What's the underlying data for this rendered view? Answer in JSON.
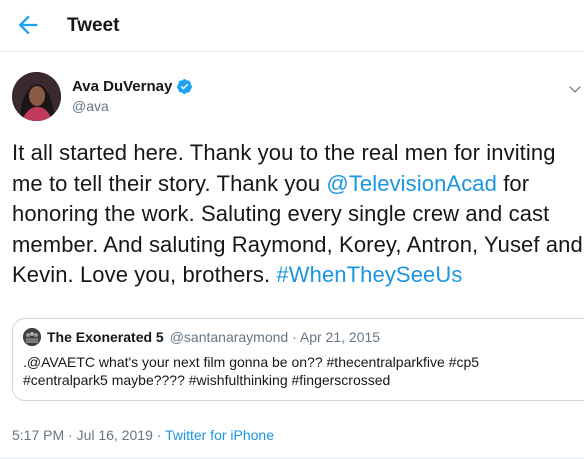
{
  "header": {
    "title": "Tweet"
  },
  "author": {
    "name": "Ava DuVernay",
    "handle": "@ava"
  },
  "tweet": {
    "segments": [
      {
        "text": "It all started here. Thank you to the real men for inviting me to tell their story. Thank you ",
        "link": false
      },
      {
        "text": "@TelevisionAcad",
        "link": true
      },
      {
        "text": " for honoring the work. Saluting every single crew and cast member. And saluting Raymond, Korey, Antron, Yusef and Kevin. Love you, brothers. ",
        "link": false
      },
      {
        "text": "#WhenTheySeeUs",
        "link": true
      }
    ]
  },
  "quote": {
    "name": "The Exonerated 5",
    "meta": "@santanaraymond · Apr 21, 2015",
    "text_line1": ".@AVAETC what's your next film gonna be on?? #thecentralparkfive #cp5",
    "text_line2": "#centralpark5 maybe???? #wishfulthinking #fingerscrossed"
  },
  "footer": {
    "timestamp": "5:17 PM · Jul 16, 2019 · ",
    "source": "Twitter for iPhone"
  },
  "colors": {
    "accent": "#1b95e0",
    "verified": "#1da1f2",
    "muted": "#657786",
    "border": "#ccd6dd"
  },
  "icons": {
    "back": "arrow-left-icon",
    "verified": "verified-badge-icon",
    "menu": "chevron-down-icon"
  }
}
